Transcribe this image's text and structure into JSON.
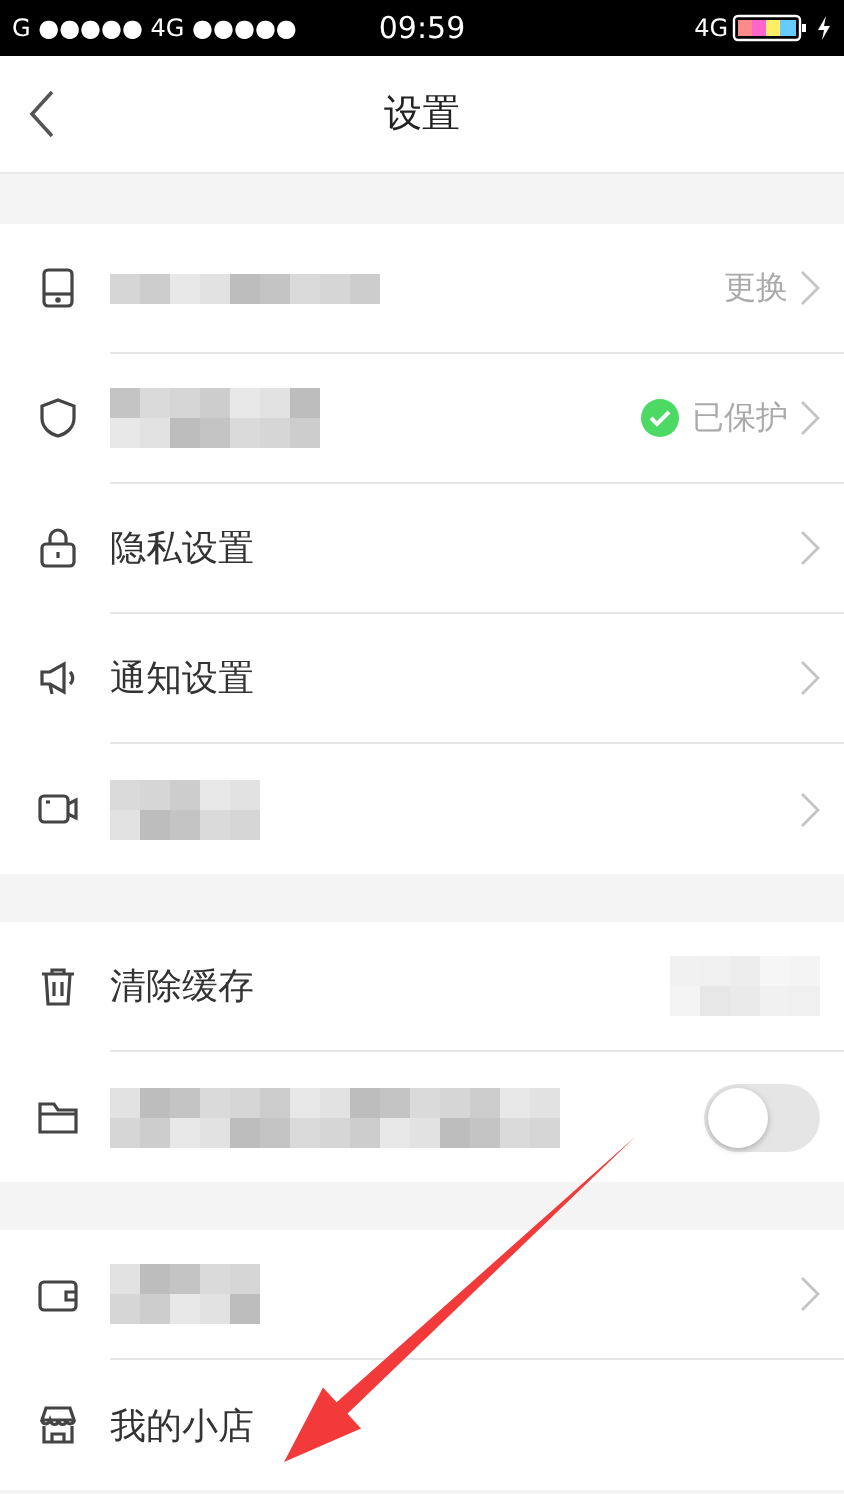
{
  "status_bar": {
    "carrier": "G ●●●●● 4G ●●●●●",
    "time": "09:59",
    "network": "4G"
  },
  "nav": {
    "title": "设置"
  },
  "groups": [
    {
      "rows": [
        {
          "masked": true,
          "value": "更换",
          "chevron": true
        },
        {
          "masked": true,
          "value": "已保护",
          "verified": true,
          "chevron": true
        },
        {
          "label": "隐私设置",
          "chevron": true
        },
        {
          "label": "通知设置",
          "chevron": true
        },
        {
          "masked": true,
          "chevron": true
        }
      ]
    },
    {
      "rows": [
        {
          "label": "清除缓存",
          "value_masked": true,
          "chevron": false
        },
        {
          "masked": true,
          "toggle": {
            "on": false
          },
          "chevron": false
        }
      ]
    },
    {
      "rows": [
        {
          "masked": true,
          "chevron": true
        },
        {
          "label": "我的小店",
          "chevron": false
        }
      ]
    }
  ],
  "annotation": {
    "kind": "arrow"
  }
}
